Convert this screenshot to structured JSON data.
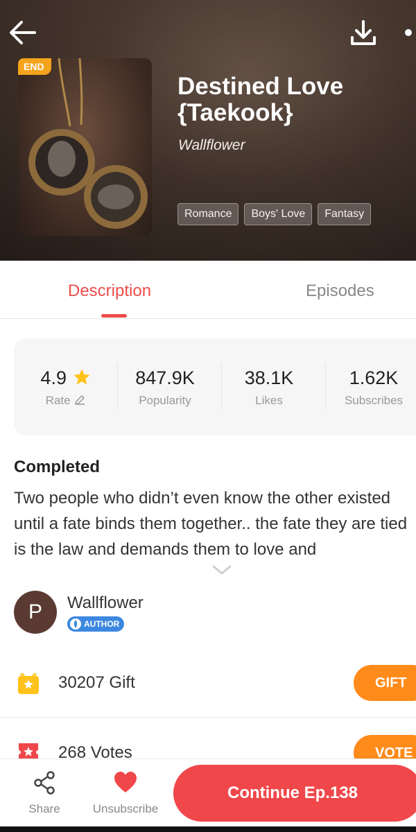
{
  "header": {
    "end_badge": "END",
    "title": "Destined Love {Taekook}",
    "author": "Wallflower",
    "tags": [
      "Romance",
      "Boys' Love",
      "Fantasy"
    ],
    "icons": {
      "back": "back-arrow-icon",
      "download": "download-icon",
      "more": "more-icon"
    }
  },
  "tabs": {
    "description": "Description",
    "episodes": "Episodes",
    "active": "Description",
    "active_color": "#ec4d4a"
  },
  "stats": {
    "rate": {
      "value": "4.9",
      "label": "Rate"
    },
    "popularity": {
      "value": "847.9K",
      "label": "Popularity"
    },
    "likes": {
      "value": "38.1K",
      "label": "Likes"
    },
    "subscribes": {
      "value": "1.62K",
      "label": "Subscribes"
    }
  },
  "story": {
    "status": "Completed",
    "description": "Two people who didn’t even know the other existed until a fate binds them together.. the fate they are tied is the law and demands them to love and"
  },
  "author": {
    "avatar_letter": "P",
    "name": "Wallflower",
    "badge": "AUTHOR"
  },
  "gift": {
    "text": "30207 Gift",
    "button": "GIFT"
  },
  "vote": {
    "text": "268 Votes",
    "button": "VOTE"
  },
  "bottom_bar": {
    "share": "Share",
    "unsubscribe": "Unsubscribe",
    "continue": "Continue Ep.138"
  },
  "colors": {
    "accent_red": "#f0474a",
    "orange": "#ff8b1a",
    "gift_yellow": "#ffc21a",
    "author_badge_blue": "#3c88e0"
  }
}
